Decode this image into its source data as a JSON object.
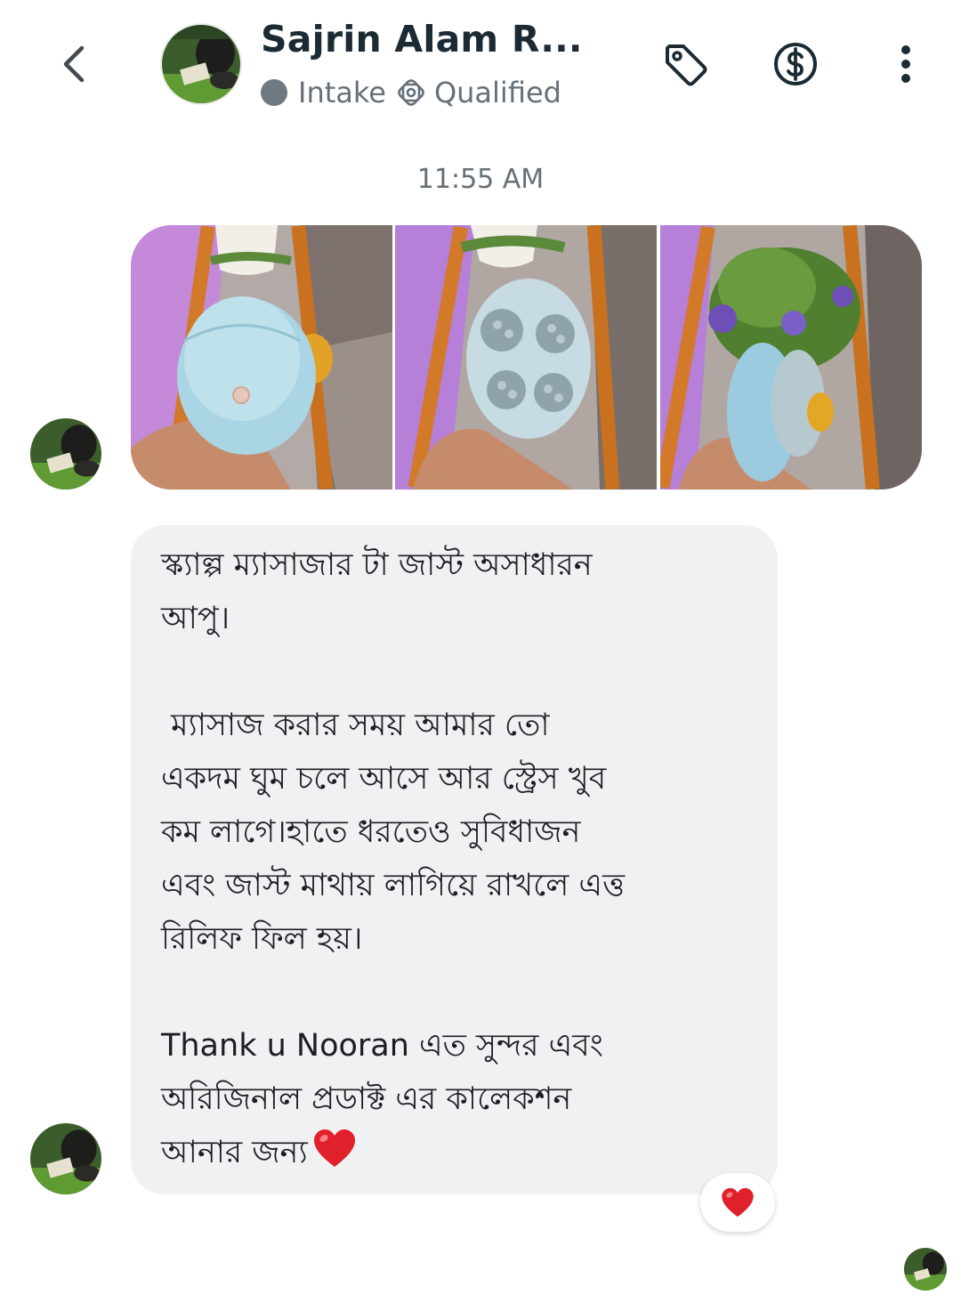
{
  "header": {
    "contact_name": "Sajrin Alam R...",
    "status_label": "Intake",
    "stage_label": "Qualified",
    "status_dot_color": "#707980",
    "icons": [
      "back-chevron-icon",
      "tag-icon",
      "dollar-icon",
      "more-vertical-icon"
    ]
  },
  "conversation": {
    "timestamp": "11:55 AM",
    "gallery": {
      "count": 3,
      "items": [
        "photo-scalp-massager-front",
        "photo-scalp-massager-bristles",
        "photo-scalp-massager-side"
      ]
    },
    "message": {
      "lines": [
        "স্ক্যাল্প ম্যাসাজার টা জাস্ট অসাধারন",
        "আপু।",
        "",
        " ম্যাসাজ করার সময় আমার তো",
        "একদম ঘুম চলে আসে আর স্ট্রেস খুব",
        "কম লাগে।হাতে ধরতেও সুবিধাজন",
        "এবং জাস্ট মাথায় লাগিয়ে রাখলে এত্ত",
        "রিলিফ ফিল হয়।",
        "",
        "Thank u Nooran এত সুন্দর এবং",
        "অরিজিনাল প্রডাক্ট এর কালেকশন",
        "আনার জন্য"
      ],
      "trailing_emoji": "❤️",
      "reaction_emoji": "❤️"
    }
  },
  "colors": {
    "bubble_bg": "#f0f1f3",
    "heart": "#e0202b",
    "muted_text": "#65707a"
  }
}
